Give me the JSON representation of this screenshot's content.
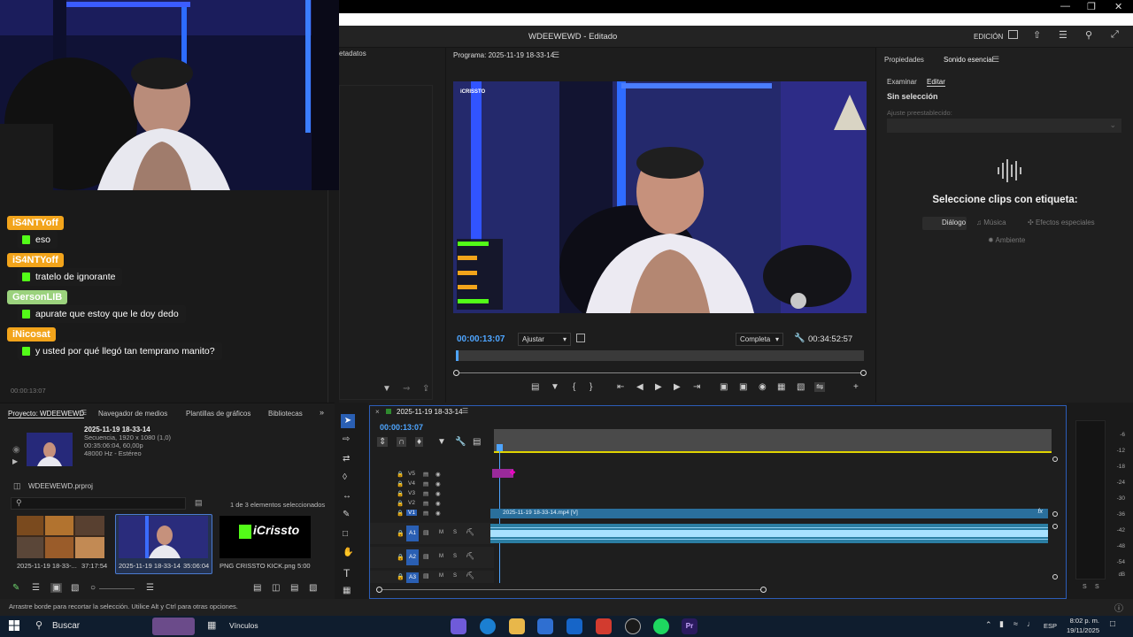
{
  "window": {
    "title": "WDEEWEWD",
    "edited": "Editado",
    "workspace": "EDICIÓN"
  },
  "source_tab_partial": "etadatos",
  "program_monitor": {
    "title": "Programa: 2025-11-19 18-33-14",
    "timecode": "00:00:13:07",
    "fit": "Ajustar",
    "quality": "Completa",
    "duration": "00:34:52:57",
    "video_watermark": "iCRISSTO"
  },
  "chat": {
    "messages": [
      {
        "user": "iS4NTYoff",
        "text": "eso",
        "color": "#f2a41b"
      },
      {
        "user": "iS4NTYoff",
        "text": "tratelo de ignorante",
        "color": "#f2a41b"
      },
      {
        "user": "GersonLIB",
        "text": "apurate que estoy que le doy dedo",
        "color": "#9bd27d"
      },
      {
        "user": "iNicosat",
        "text": "y usted por qué llegó tan temprano manito?",
        "color": "#f2a41b"
      }
    ],
    "source_timecode": "00:00:13:07"
  },
  "essential_sound": {
    "tabs": [
      "Propiedades",
      "Sonido esencial"
    ],
    "subtabs": [
      "Examinar",
      "Editar"
    ],
    "no_selection": "Sin selección",
    "preset_label": "Ajuste preestablecido:",
    "prompt": "Seleccione clips con etiqueta:",
    "types": [
      "Diálogo",
      "Música",
      "Efectos especiales",
      "Ambiente"
    ]
  },
  "project": {
    "tabs": [
      "Proyecto: WDEEWEWD",
      "Navegador de medios",
      "Plantillas de gráficos",
      "Bibliotecas"
    ],
    "seq_name": "2025-11-19 18-33-14",
    "seq_info1": "Secuencia, 1920 x 1080 (1,0)",
    "seq_info2": "00:35:06:04, 60,00p",
    "seq_info3": "48000 Hz - Estéreo",
    "file": "WDEEWEWD.prproj",
    "selection_count": "1 de 3 elementos seleccionados",
    "items": [
      {
        "name": "2025-11-19 18-33-...",
        "duration": "37:17:54"
      },
      {
        "name": "2025-11-19 18-33-14",
        "duration": "35:06:04"
      },
      {
        "name": "PNG CRISSTO KICK.png",
        "duration": "5:00"
      }
    ],
    "kick_logo": "iCrissto"
  },
  "timeline": {
    "sequence": "2025-11-19 18-33-14",
    "timecode": "00:00:13:07",
    "video_tracks": [
      "V5",
      "V4",
      "V3",
      "V2",
      "V1"
    ],
    "audio_tracks": [
      "A1",
      "A2",
      "A3"
    ],
    "clip_label": "2025-11-19 18-33-14.mp4 [V]",
    "clip_fx": "fx"
  },
  "meters": {
    "scale": [
      "-6",
      "-12",
      "-18",
      "-24",
      "-30",
      "-36",
      "-42",
      "-48",
      "-54",
      "dB"
    ],
    "solo": [
      "S",
      "S"
    ]
  },
  "status": {
    "hint": "Arrastre borde para recortar la selección. Utilice Alt y Ctrl para otras opciones."
  },
  "taskbar": {
    "search": "Buscar",
    "vinculos": "Vínculos",
    "lang": "ESP",
    "time": "8:02 p. m.",
    "date": "19/11/2025"
  }
}
